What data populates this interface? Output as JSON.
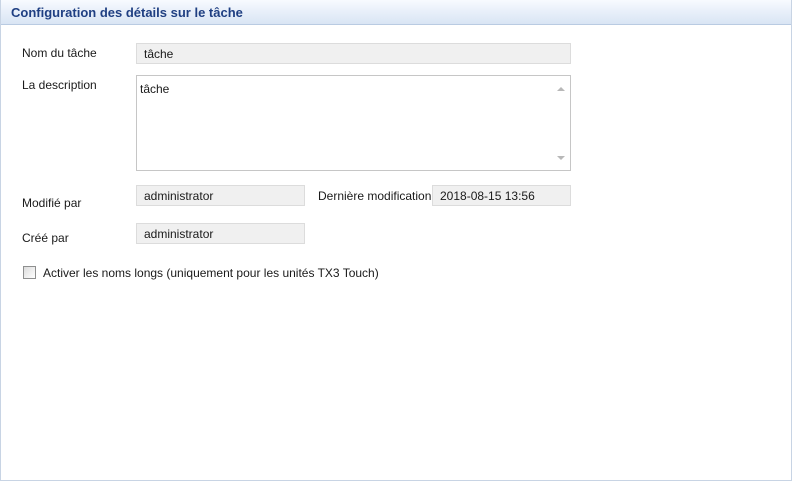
{
  "header": {
    "title": "Configuration des détails sur le tâche"
  },
  "form": {
    "task_name_label": "Nom du tâche",
    "task_name_value": "tâche",
    "description_label": "La description",
    "description_value": "tâche",
    "modified_by_label": "Modifié par",
    "modified_by_value": "administrator",
    "last_modified_label": "Dernière modification",
    "last_modified_value": "2018-08-15 13:56",
    "created_by_label": "Créé par",
    "created_by_value": "administrator",
    "long_names_checkbox_label": "Activer les noms longs (uniquement pour les unités TX3 Touch)",
    "long_names_checked": false
  },
  "icons": {
    "scroll_up": "scroll-up-arrow-icon",
    "scroll_down": "scroll-down-arrow-icon"
  },
  "colors": {
    "header_title": "#1f3f82",
    "header_gradient_top": "#f8fbff",
    "header_gradient_bottom": "#d9e5f4",
    "readonly_field_bg": "#f0f0f0"
  }
}
